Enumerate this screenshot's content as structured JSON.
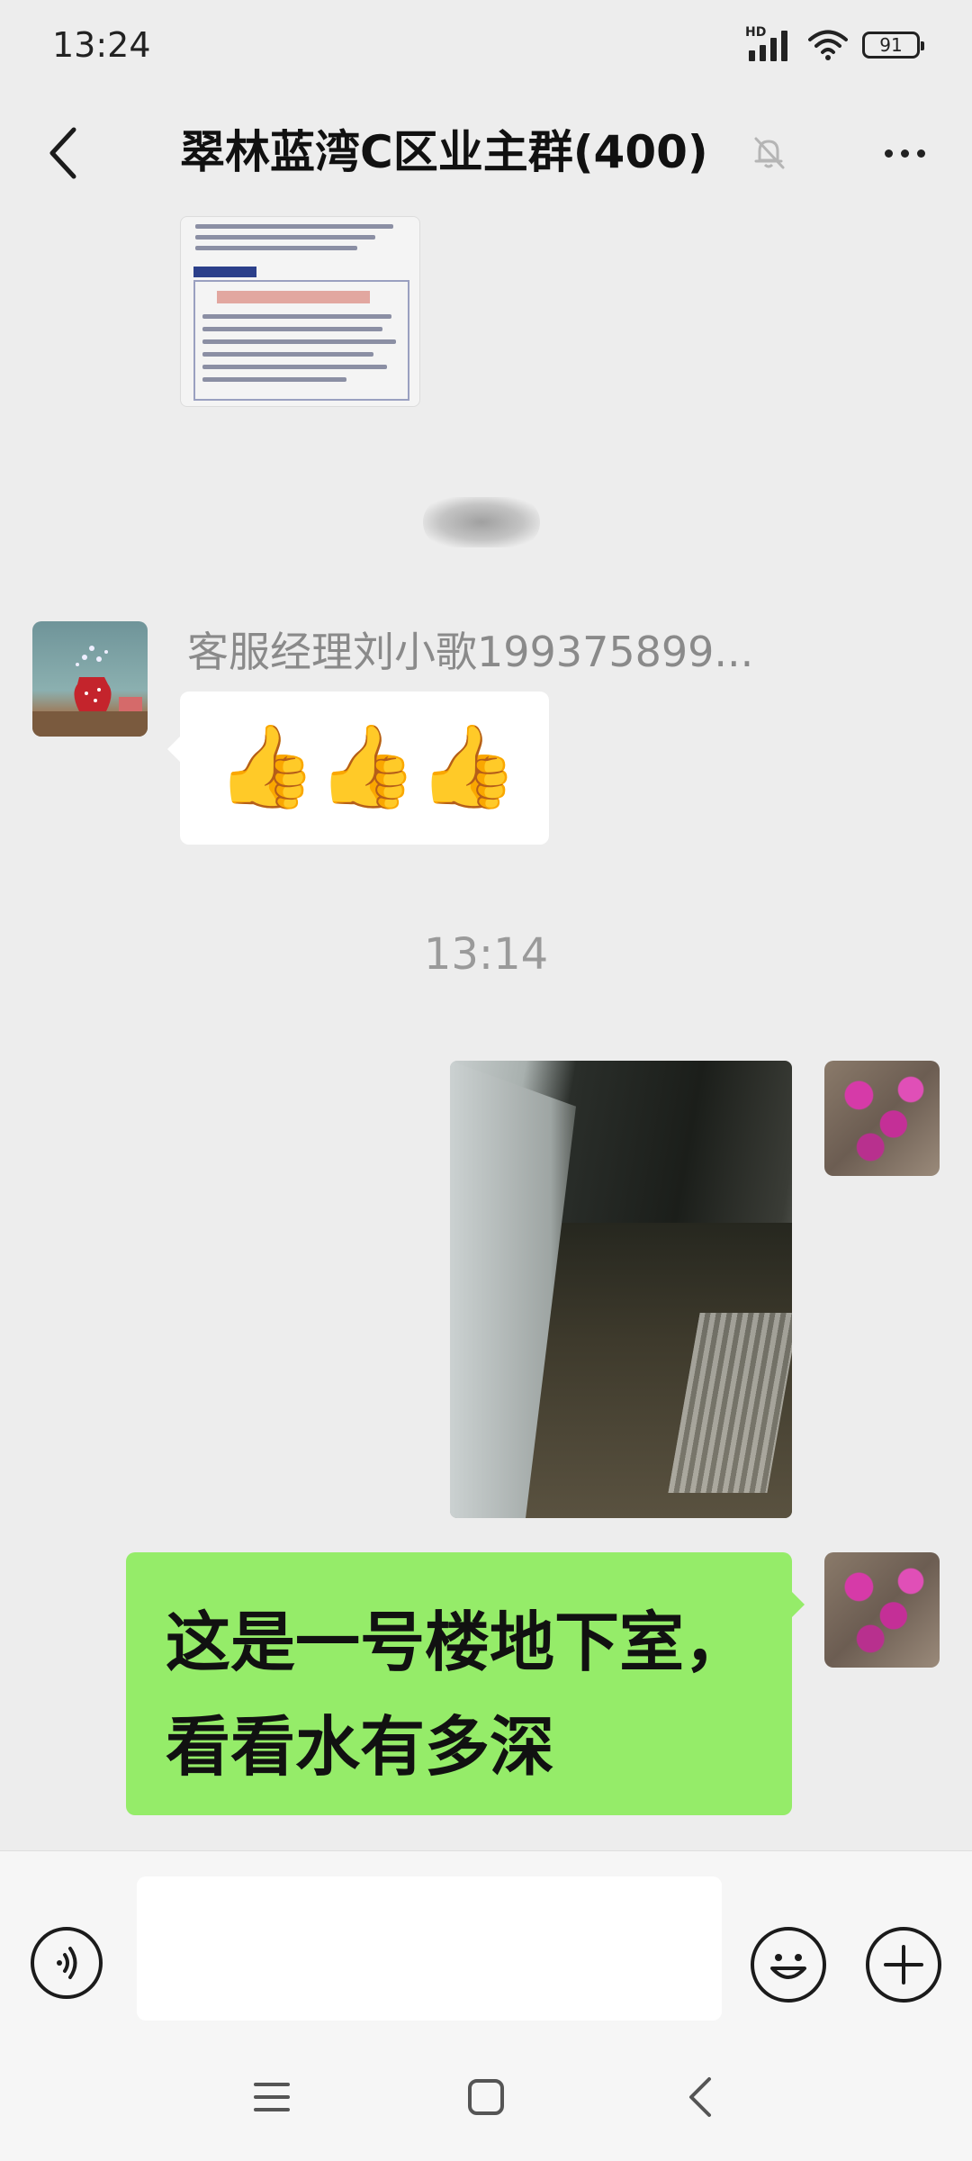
{
  "status_bar": {
    "time": "13:24",
    "network_label": "HD",
    "battery_level": "91"
  },
  "header": {
    "title": "翠林蓝湾C区业主群(400)",
    "back_icon": "chevron-left-icon",
    "mute_icon": "bell-off-icon",
    "more_icon": "more-dots-icon"
  },
  "messages": {
    "m1": {
      "type": "image",
      "sender": "other",
      "description_icon": "document-thumbnail"
    },
    "m2": {
      "type": "sticker",
      "sender": "other",
      "emoji": "👍"
    },
    "m3": {
      "sender_name": "客服经理刘小歌199375899...",
      "emojis": [
        "👍",
        "👍",
        "👍"
      ]
    },
    "time_separator": "13:14",
    "m4": {
      "type": "image",
      "sender": "self"
    },
    "m5": {
      "type": "text",
      "sender": "self",
      "lines": [
        "这是一号楼地下室，",
        "看看水有多深"
      ]
    }
  },
  "input_bar": {
    "voice_icon": "voice-icon",
    "text_value": "",
    "emoji_icon": "smiley-icon",
    "plus_icon": "plus-icon"
  },
  "system_nav": {
    "menu_icon": "menu-icon",
    "home_icon": "home-square-icon",
    "back_icon": "back-triangle-icon"
  },
  "colors": {
    "background": "#ededed",
    "self_bubble": "#95ec69",
    "other_bubble": "#ffffff",
    "muted_text": "#8a8a8a"
  }
}
